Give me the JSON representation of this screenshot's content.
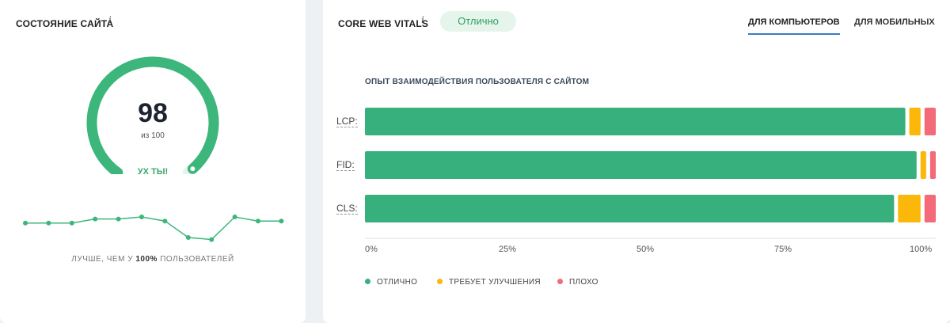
{
  "health": {
    "title": "Состояние сайта",
    "info": "i",
    "score": "98",
    "score_max": "из 100",
    "score_fraction": 0.98,
    "verdict": "УХ ТЫ!",
    "better_prefix": "Лучше, чем у ",
    "better_value": "100%",
    "better_suffix": " пользователей",
    "colors": {
      "accent": "#3db67b",
      "track": "#e6f4ec"
    },
    "trend": [
      7,
      7,
      7,
      9,
      9,
      10,
      8,
      0,
      -1,
      10,
      8,
      8
    ]
  },
  "cwv": {
    "title": "Core Web Vitals",
    "info": "i",
    "status": "Отлично",
    "tabs": [
      {
        "label": "Для компьютеров",
        "active": true
      },
      {
        "label": "Для мобильных",
        "active": false
      }
    ],
    "section_label": "Опыт взаимодействия пользователя с сайтом",
    "legend": [
      {
        "label": "Отлично",
        "color": "#37b07d"
      },
      {
        "label": "Требует улучшения",
        "color": "#fbb80a"
      },
      {
        "label": "Плохо",
        "color": "#f36b78"
      }
    ]
  },
  "chart_data": {
    "type": "bar",
    "orientation": "horizontal",
    "stacked": true,
    "categories": [
      "LCP:",
      "FID:",
      "CLS:"
    ],
    "series": [
      {
        "name": "Отлично",
        "values": [
          96,
          98,
          94
        ]
      },
      {
        "name": "Требует улучшения",
        "values": [
          2,
          1,
          4
        ]
      },
      {
        "name": "Плохо",
        "values": [
          2,
          1,
          2
        ]
      }
    ],
    "x_ticks": [
      "0%",
      "25%",
      "50%",
      "75%",
      "100%"
    ],
    "xlim": [
      0,
      100
    ]
  }
}
